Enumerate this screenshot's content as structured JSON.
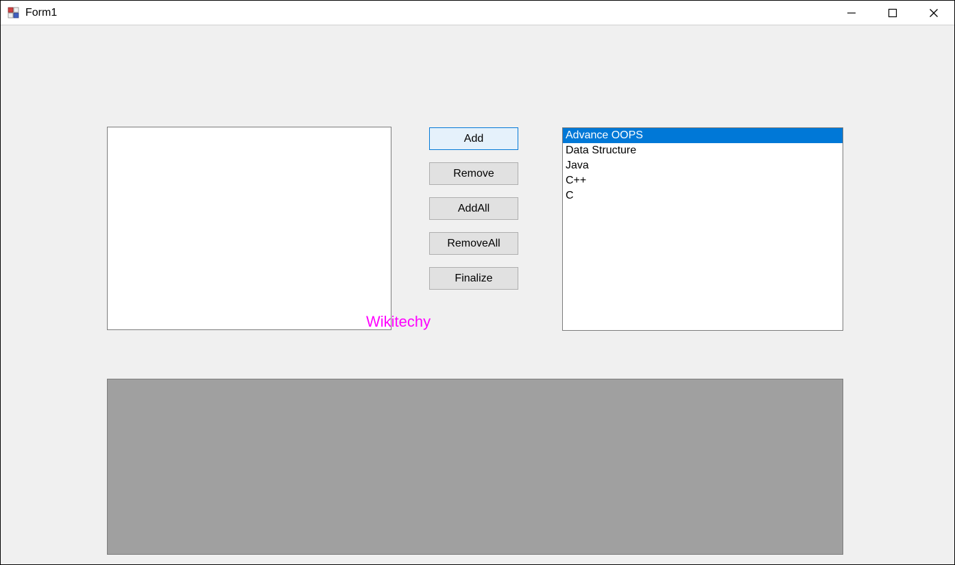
{
  "window": {
    "title": "Form1"
  },
  "buttons": {
    "add": "Add",
    "remove": "Remove",
    "addall": "AddAll",
    "removeall": "RemoveAll",
    "finalize": "Finalize"
  },
  "leftListbox": {
    "items": []
  },
  "rightListbox": {
    "items": [
      {
        "label": "Advance OOPS",
        "selected": true
      },
      {
        "label": "Data Structure",
        "selected": false
      },
      {
        "label": "Java",
        "selected": false
      },
      {
        "label": "C++",
        "selected": false
      },
      {
        "label": "C",
        "selected": false
      }
    ]
  },
  "watermark": "Wikitechy"
}
